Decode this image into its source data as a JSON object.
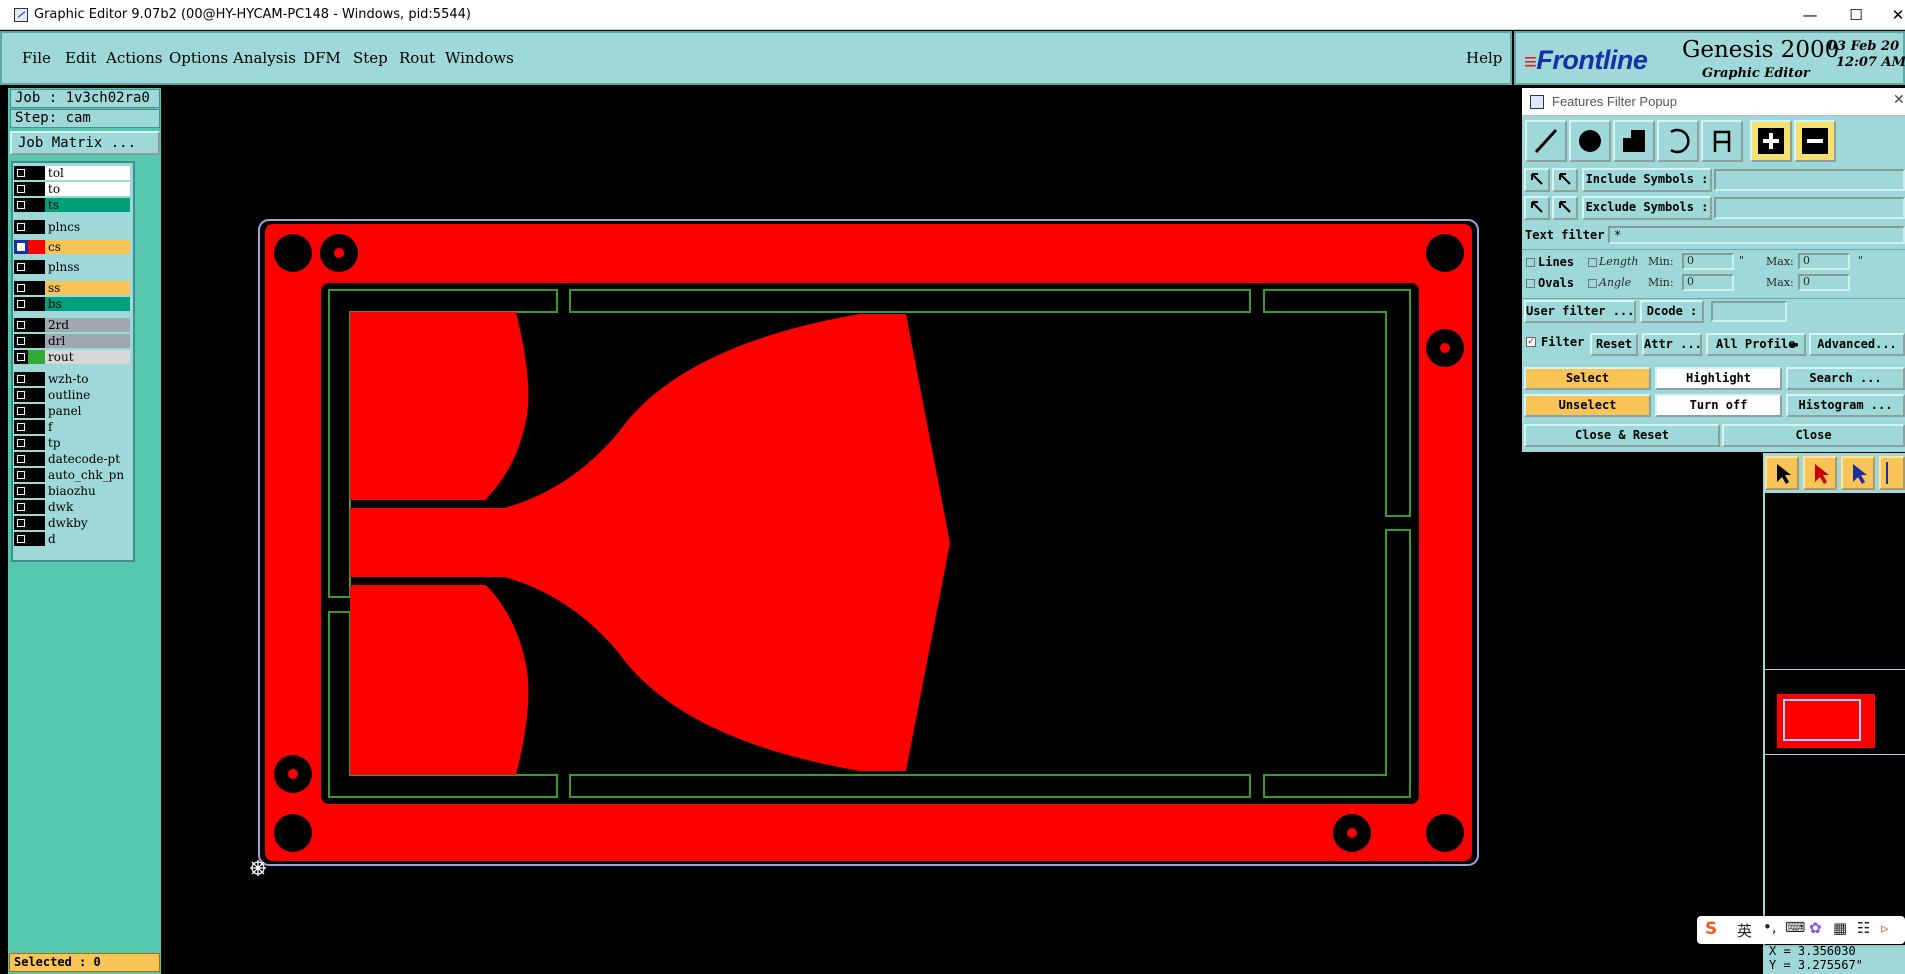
{
  "window": {
    "title": "Graphic Editor 9.07b2 (00@HY-HYCAM-PC148 - Windows, pid:5544)"
  },
  "menu": [
    "File",
    "Edit",
    "Actions",
    "Options",
    "Analysis",
    "DFM",
    "Step",
    "Rout",
    "Windows"
  ],
  "help": "Help",
  "brand": {
    "logo": "Frontline",
    "product": "Genesis 2000",
    "subtitle": "Graphic Editor",
    "date": "03 Feb 20",
    "time": "12:07 AM"
  },
  "job": {
    "job": "Job : 1v3ch02ra0",
    "step": "Step: cam",
    "matrix": "Job Matrix ..."
  },
  "layers": [
    {
      "name": "tol",
      "color": "#ffffff",
      "mark": "#000000",
      "selected": false
    },
    {
      "name": "to",
      "color": "#ffffff",
      "mark": "#000000",
      "selected": false
    },
    {
      "name": "ts",
      "color": "#00a07a",
      "mark": "#000000",
      "selected": false
    },
    {
      "name": "plncs",
      "color": "#9ed8d8",
      "mark": "#000000",
      "selected": false
    },
    {
      "name": "cs",
      "color": "#f8c455",
      "mark": "#ff0000",
      "selected": true
    },
    {
      "name": "plnss",
      "color": "#9ed8d8",
      "mark": "#000000",
      "selected": false
    },
    {
      "name": "ss",
      "color": "#f8c455",
      "mark": "#000000",
      "selected": false
    },
    {
      "name": "bs",
      "color": "#00a07a",
      "mark": "#000000",
      "selected": false
    },
    {
      "name": "2rd",
      "color": "#a0a8b0",
      "mark": "#000000",
      "selected": false
    },
    {
      "name": "drl",
      "color": "#a0a8b0",
      "mark": "#000000",
      "selected": false
    },
    {
      "name": "rout",
      "color": "#d8d8d8",
      "mark": "#33aa33",
      "selected": false
    },
    {
      "name": "wzh-to",
      "color": "#9ed8d8",
      "mark": "#000000",
      "selected": false
    },
    {
      "name": "outline",
      "color": "#9ed8d8",
      "mark": "#000000",
      "selected": false
    },
    {
      "name": "panel",
      "color": "#9ed8d8",
      "mark": "#000000",
      "selected": false
    },
    {
      "name": "f",
      "color": "#9ed8d8",
      "mark": "#000000",
      "selected": false
    },
    {
      "name": "tp",
      "color": "#9ed8d8",
      "mark": "#000000",
      "selected": false
    },
    {
      "name": "datecode-pt",
      "color": "#9ed8d8",
      "mark": "#000000",
      "selected": false
    },
    {
      "name": "auto_chk_pn",
      "color": "#9ed8d8",
      "mark": "#000000",
      "selected": false
    },
    {
      "name": "biaozhu",
      "color": "#9ed8d8",
      "mark": "#000000",
      "selected": false
    },
    {
      "name": "dwk",
      "color": "#9ed8d8",
      "mark": "#000000",
      "selected": false
    },
    {
      "name": "dwkby",
      "color": "#9ed8d8",
      "mark": "#000000",
      "selected": false
    },
    {
      "name": "d",
      "color": "#9ed8d8",
      "mark": "#000000",
      "selected": false
    }
  ],
  "popup": {
    "title": "Features Filter Popup",
    "include": "Include Symbols :",
    "exclude": "Exclude Symbols :",
    "text_filter": "Text filter",
    "text_filter_value": "*",
    "lines": "Lines",
    "ovals": "Ovals",
    "length": "Length",
    "angle": "Angle",
    "min": "Min:",
    "max": "Max:",
    "len_min": "0",
    "len_max": "0",
    "ang_min": "0",
    "ang_max": "0",
    "unit": "\"",
    "user_filter": "User filter ...",
    "dcode": "Dcode :",
    "filter": "Filter",
    "reset": "Reset",
    "attr": "Attr ...",
    "profile": "All Profile",
    "advanced": "Advanced...",
    "select": "Select",
    "highlight": "Highlight",
    "search": "Search ...",
    "unselect": "Unselect",
    "turn_off": "Turn off",
    "histogram": "Histogram ...",
    "close_reset": "Close & Reset",
    "close": "Close"
  },
  "status": {
    "selected": "Selected : 0",
    "x": "X = 3.356030",
    "y": "Y = 3.275567\""
  },
  "ime": {
    "lang": "英"
  },
  "colors": {
    "panel": "#9ed8d8",
    "accent": "#f8c455",
    "copper": "#ff0000",
    "rout": "#3a9a2a",
    "left": "#56c8b0"
  }
}
